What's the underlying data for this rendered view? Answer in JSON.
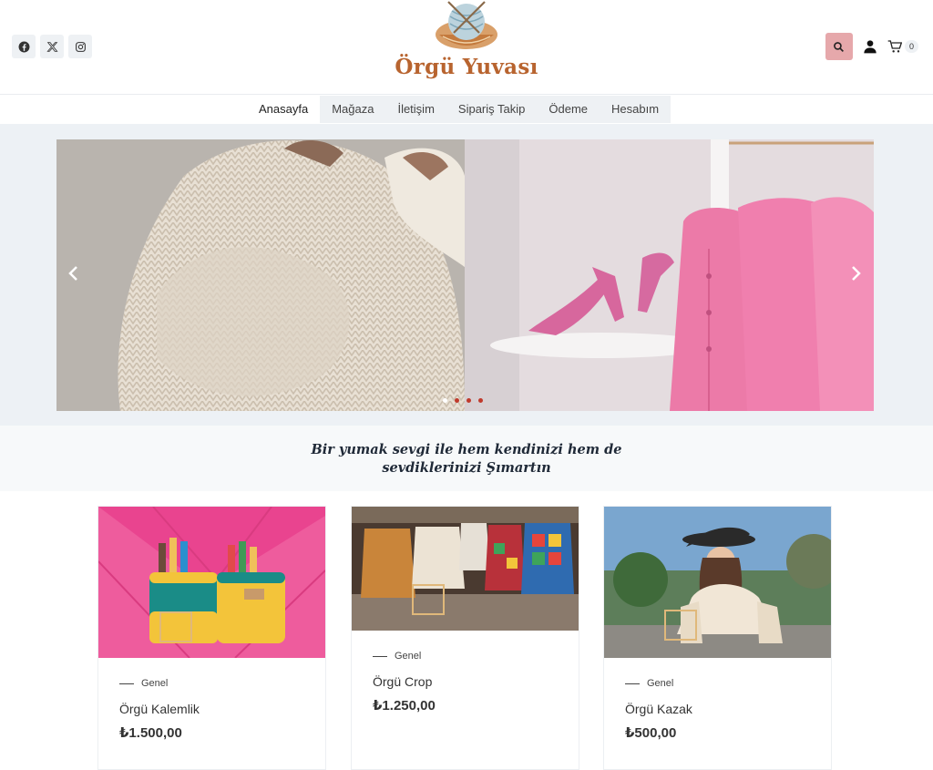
{
  "site": {
    "logo_text": "Örgü Yuvası"
  },
  "social": [
    {
      "icon": "facebook-icon"
    },
    {
      "icon": "x-twitter-icon"
    },
    {
      "icon": "instagram-icon"
    }
  ],
  "header_tools": {
    "search_icon": "search-icon",
    "account_icon": "user-icon",
    "cart_icon": "cart-icon",
    "cart_count": "0"
  },
  "nav": {
    "items": [
      "Anasayfa",
      "Mağaza",
      "İletişim",
      "Sipariş Takip",
      "Ödeme",
      "Hesabım"
    ],
    "active": "Anasayfa"
  },
  "slider": {
    "prev_icon": "chevron-left-icon",
    "next_icon": "chevron-right-icon",
    "dot_count": 4,
    "active_dot": 1
  },
  "tagline": {
    "line1": "Bir yumak sevgi ile hem kendinizi hem de",
    "line2": "sevdiklerinizi Şımartın"
  },
  "products": [
    {
      "category": "Genel",
      "name": "Örgü Kalemlik",
      "price": "₺1.500,00"
    },
    {
      "category": "Genel",
      "name": "Örgü Crop",
      "price": "₺1.250,00"
    },
    {
      "category": "Genel",
      "name": "Örgü Kazak",
      "price": "₺500,00"
    }
  ],
  "colors": {
    "brand": "#b8642f",
    "search_button": "#e6a8ab",
    "nav_bg": "#eef1f4",
    "slider_dot": "#c0392b"
  }
}
